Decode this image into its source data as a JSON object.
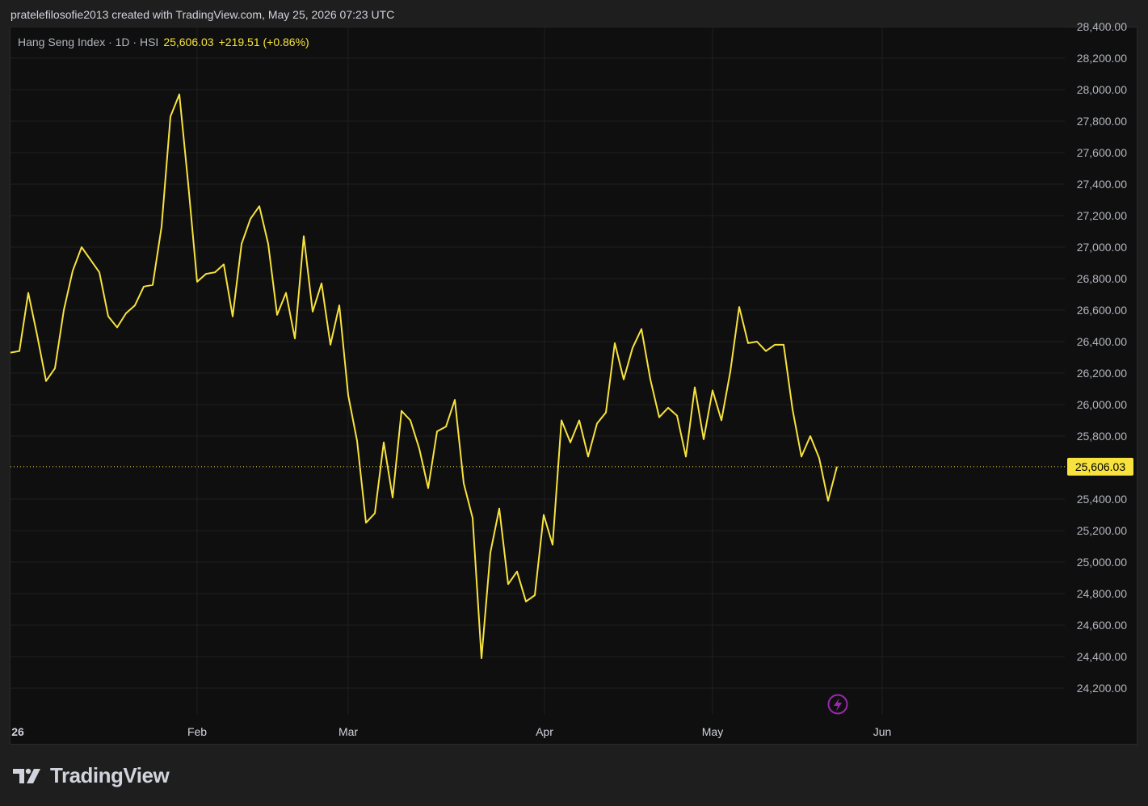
{
  "header": {
    "credit": "pratelefilosofie2013 created with TradingView.com, May 25, 2026 07:23 UTC"
  },
  "legend": {
    "symbol": "Hang Seng Index · 1D · HSI",
    "price": "25,606.03",
    "change": "+219.51 (+0.86%)"
  },
  "brand": {
    "name": "TradingView",
    "icon": "tradingview-logo-icon"
  },
  "colors": {
    "line": "#f7e23e",
    "background": "#0f0f0f",
    "grid": "#1f1f1f",
    "price_label_bg": "#f7e23e",
    "marker": "#9c27b0"
  },
  "chart_data": {
    "type": "line",
    "series": [
      {
        "values": [
          26330,
          26340,
          26710,
          26440,
          26150,
          26230,
          26600,
          26850,
          27000,
          26920,
          26840,
          26560,
          26490,
          26580,
          26630,
          26750,
          26760,
          27130,
          27830,
          27970,
          27400,
          26780,
          26830,
          26840,
          26890,
          26560,
          27020,
          27180,
          27260,
          27020,
          26570,
          26710,
          26420,
          27070,
          26590,
          26770,
          26380,
          26630,
          26060,
          25770,
          25250,
          25310,
          25760,
          25410,
          25960,
          25900,
          25720,
          25470,
          25830,
          25860,
          26030,
          25500,
          25280,
          24390,
          25060,
          25340,
          24860,
          24940,
          24750,
          24790,
          25300,
          25110,
          25900,
          25760,
          25900,
          25670,
          25880,
          25950,
          26390,
          26160,
          26360,
          26480,
          26160,
          25920,
          25980,
          25930,
          25670,
          26110,
          25780,
          26090,
          25900,
          26210,
          26620,
          26390,
          26400,
          26340,
          26380,
          26380,
          25970,
          25670,
          25800,
          25660,
          25390,
          25606.03
        ]
      }
    ],
    "x_ticks": [
      "26",
      "Feb",
      "Mar",
      "Apr",
      "May",
      "Jun"
    ],
    "y_ticks": [
      "28,400.00",
      "28,200.00",
      "28,000.00",
      "27,800.00",
      "27,600.00",
      "27,400.00",
      "27,200.00",
      "27,000.00",
      "26,800.00",
      "26,600.00",
      "26,400.00",
      "26,200.00",
      "26,000.00",
      "25,800.00",
      "25,400.00",
      "25,200.00",
      "25,000.00",
      "24,800.00",
      "24,600.00",
      "24,400.00",
      "24,200.00"
    ],
    "ylim": [
      24200,
      28400
    ],
    "last_price": 25606.03,
    "last_price_label": "25,606.03",
    "grid": true
  }
}
